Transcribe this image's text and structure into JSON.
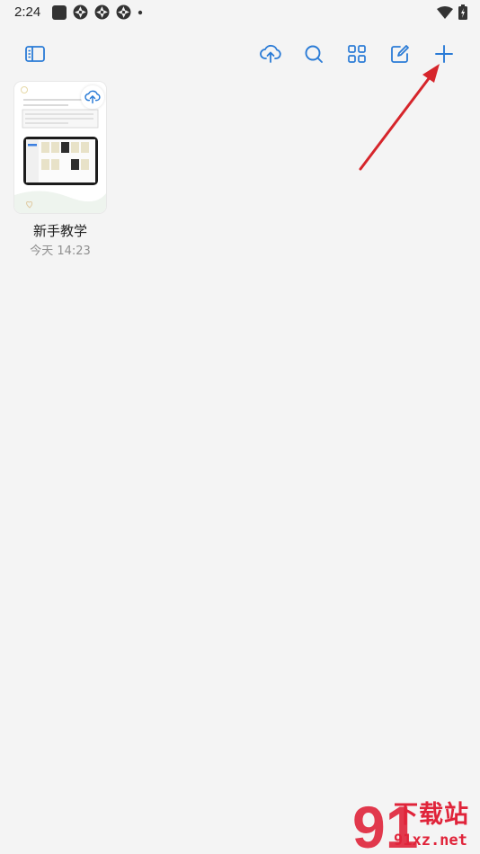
{
  "status_bar": {
    "time": "2:24",
    "icons": [
      "app-square-icon",
      "aperture-icon",
      "aperture-icon",
      "aperture-icon",
      "dot-icon"
    ],
    "right_icons": [
      "wifi-icon",
      "battery-charging-icon"
    ]
  },
  "toolbar": {
    "left": [
      "sidebar-toggle-icon"
    ],
    "right": [
      "cloud-upload-icon",
      "search-icon",
      "grid-view-icon",
      "edit-note-icon",
      "plus-icon"
    ],
    "accent": "#2a7bd6"
  },
  "notes": [
    {
      "title": "新手教学",
      "time": "今天 14:23"
    }
  ],
  "annotation": {
    "arrow_color": "#d6252b",
    "points_to": "plus-icon"
  },
  "watermark": {
    "text": "下载站",
    "domain": "91xz.net",
    "logo": "91",
    "color": "#e0243a"
  }
}
